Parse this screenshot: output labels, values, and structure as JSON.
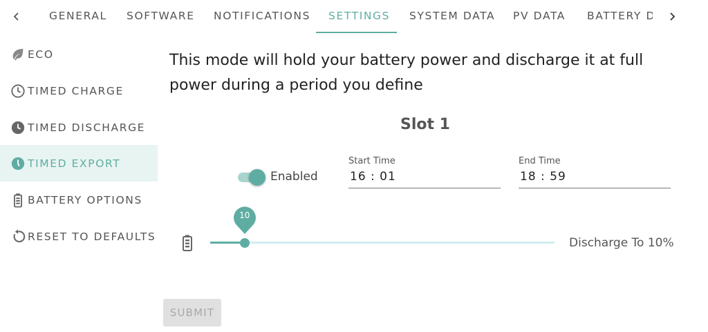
{
  "tabs": {
    "items": [
      {
        "label": "GENERAL"
      },
      {
        "label": "SOFTWARE"
      },
      {
        "label": "NOTIFICATIONS"
      },
      {
        "label": "SETTINGS"
      },
      {
        "label": "SYSTEM DATA"
      },
      {
        "label": "PV DATA"
      },
      {
        "label": "BATTERY DATA"
      }
    ],
    "active": "SETTINGS",
    "left_arrow_icon": "chevron-left-icon",
    "right_arrow_icon": "chevron-right-icon"
  },
  "sidebar": {
    "items": [
      {
        "label": "ECO",
        "icon": "leaf-icon"
      },
      {
        "label": "TIMED CHARGE",
        "icon": "clock-outline-icon"
      },
      {
        "label": "TIMED DISCHARGE",
        "icon": "clock-filled-icon"
      },
      {
        "label": "TIMED EXPORT",
        "icon": "clock-filled-icon"
      },
      {
        "label": "BATTERY OPTIONS",
        "icon": "battery-icon"
      },
      {
        "label": "RESET TO DEFAULTS",
        "icon": "reset-icon"
      }
    ],
    "active": "TIMED EXPORT"
  },
  "main": {
    "description": "This mode will hold your battery power and discharge it at full power during a period you define",
    "slot_title": "Slot 1",
    "toggle": {
      "label": "Enabled",
      "on": true
    },
    "start_time": {
      "label": "Start Time",
      "value": "16 : 01"
    },
    "end_time": {
      "label": "End Time",
      "value": "18 : 59"
    },
    "slider": {
      "value": 10,
      "min": 0,
      "max": 100,
      "bubble": "10",
      "caption": "Discharge To 10%"
    },
    "submit_label": "SUBMIT"
  },
  "colors": {
    "accent": "#5fada2",
    "active_bg": "#e8f4f2",
    "track": "#cfeef0",
    "text": "#555555"
  }
}
